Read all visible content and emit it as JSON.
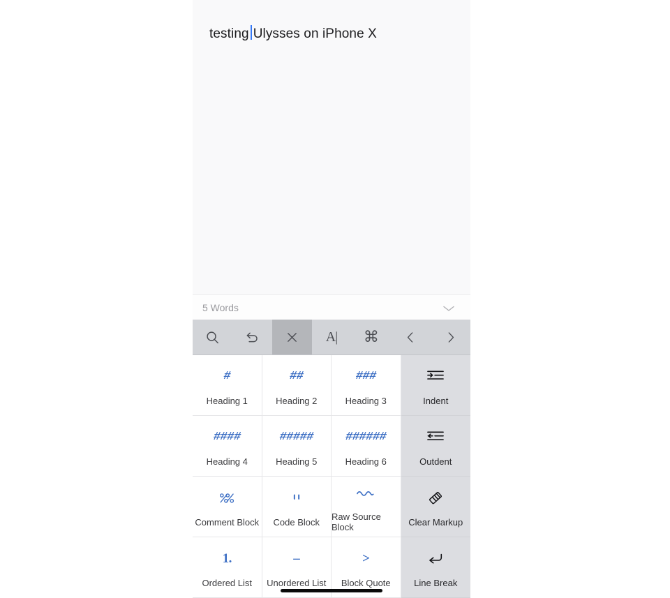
{
  "editor": {
    "text_before_caret": "testing",
    "text_after_caret": "Ulysses on iPhone X",
    "caret_color": "#3478f6"
  },
  "wordbar": {
    "count_label": "5 Words",
    "collapse_icon": "chevron-down-icon"
  },
  "toolbar": {
    "buttons": [
      {
        "name": "search",
        "icon": "search-icon",
        "active": false
      },
      {
        "name": "undo",
        "icon": "undo-icon",
        "active": false
      },
      {
        "name": "close",
        "icon": "close-icon",
        "active": true
      },
      {
        "name": "text-format",
        "icon": "text-cursor-icon",
        "glyph": "A|",
        "active": false
      },
      {
        "name": "command",
        "icon": "command-icon",
        "glyph": "⌘",
        "active": false
      }
    ],
    "nav": [
      {
        "name": "previous",
        "icon": "chevron-left-icon"
      },
      {
        "name": "next",
        "icon": "chevron-right-icon"
      }
    ]
  },
  "markup_keyboard": {
    "keys": [
      {
        "glyph": "#",
        "label": "Heading 1",
        "icon": "hash-1-icon",
        "accent": true
      },
      {
        "glyph": "##",
        "label": "Heading 2",
        "icon": "hash-2-icon",
        "accent": true
      },
      {
        "glyph": "###",
        "label": "Heading 3",
        "icon": "hash-3-icon",
        "accent": true
      },
      {
        "glyph": "",
        "label": "Indent",
        "icon": "indent-icon",
        "accent": false
      },
      {
        "glyph": "####",
        "label": "Heading 4",
        "icon": "hash-4-icon",
        "accent": true
      },
      {
        "glyph": "#####",
        "label": "Heading 5",
        "icon": "hash-5-icon",
        "accent": true
      },
      {
        "glyph": "######",
        "label": "Heading 6",
        "icon": "hash-6-icon",
        "accent": true
      },
      {
        "glyph": "",
        "label": "Outdent",
        "icon": "outdent-icon",
        "accent": false
      },
      {
        "glyph": "",
        "label": "Comment Block",
        "icon": "percent-percent-icon",
        "accent": true
      },
      {
        "glyph": "",
        "label": "Code Block",
        "icon": "code-bars-icon",
        "accent": true
      },
      {
        "glyph": "",
        "label": "Raw Source Block",
        "icon": "tilde-wave-icon",
        "accent": true
      },
      {
        "glyph": "",
        "label": "Clear Markup",
        "icon": "eraser-icon",
        "accent": false
      },
      {
        "glyph": "1.",
        "label": "Ordered List",
        "icon": "ordered-list-icon",
        "accent": true
      },
      {
        "glyph": "–",
        "label": "Unordered List",
        "icon": "unordered-list-icon",
        "accent": true
      },
      {
        "glyph": ">",
        "label": "Block Quote",
        "icon": "block-quote-icon",
        "accent": true
      },
      {
        "glyph": "",
        "label": "Line Break",
        "icon": "line-break-icon",
        "accent": false
      }
    ]
  },
  "colors": {
    "accent_blue": "#3d6fc4",
    "caret_blue": "#3478f6",
    "toolbar_bg": "#d2d4d8",
    "toolbar_active": "#b4b6ba",
    "col4_bg": "#dcdde1",
    "editor_bg": "#f9f9fa"
  }
}
